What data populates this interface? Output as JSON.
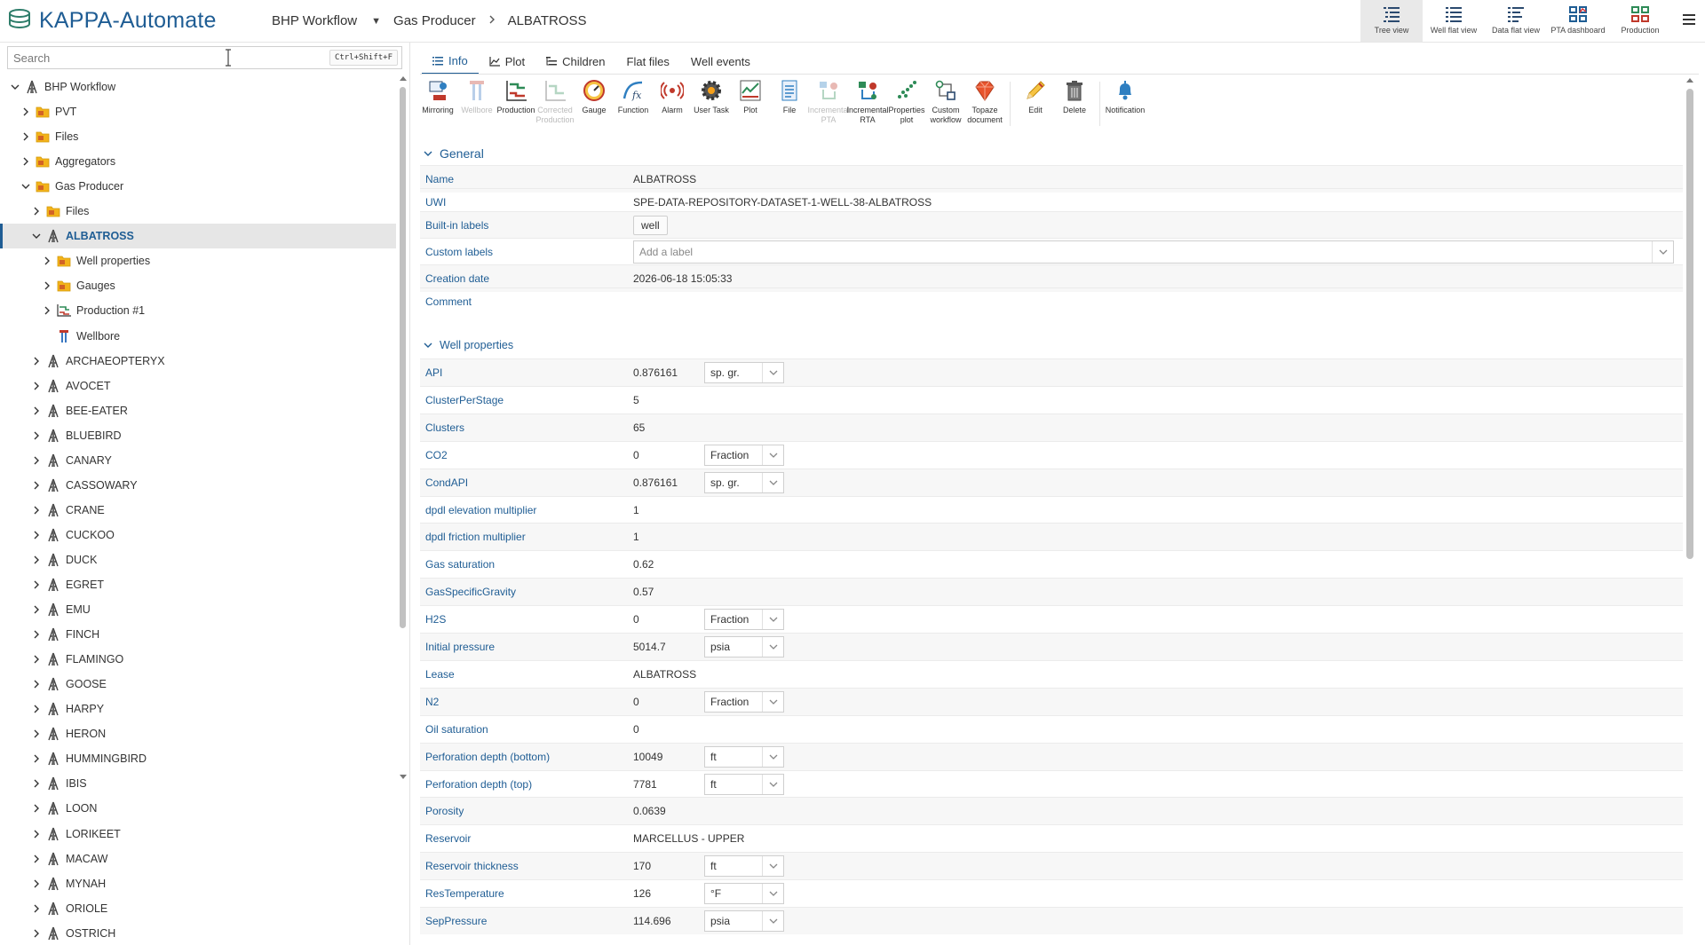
{
  "app": {
    "title": "KAPPA-Automate"
  },
  "breadcrumb": [
    "BHP Workflow",
    "Gas Producer",
    "ALBATROSS"
  ],
  "view_buttons": [
    {
      "label": "Tree view",
      "icon": "tree-view-icon",
      "active": true
    },
    {
      "label": "Well flat view",
      "icon": "list-icon",
      "active": false
    },
    {
      "label": "Data flat view",
      "icon": "list-icon",
      "active": false
    },
    {
      "label": "PTA dashboard",
      "icon": "dashboard-icon",
      "active": false
    },
    {
      "label": "Production",
      "icon": "grid-icon",
      "active": false
    }
  ],
  "search": {
    "placeholder": "Search",
    "shortcut": "Ctrl+Shift+F"
  },
  "tree": [
    {
      "label": "BHP Workflow",
      "level": 0,
      "expanded": true,
      "icon": "well-icon"
    },
    {
      "label": "PVT",
      "level": 1,
      "expanded": false,
      "icon": "folder-icon"
    },
    {
      "label": "Files",
      "level": 1,
      "expanded": false,
      "icon": "folder-icon"
    },
    {
      "label": "Aggregators",
      "level": 1,
      "expanded": false,
      "icon": "folder-icon"
    },
    {
      "label": "Gas Producer",
      "level": 1,
      "expanded": true,
      "icon": "folder-icon"
    },
    {
      "label": "Files",
      "level": 2,
      "expanded": false,
      "icon": "folder-icon"
    },
    {
      "label": "ALBATROSS",
      "level": 2,
      "expanded": true,
      "icon": "well-icon",
      "selected": true
    },
    {
      "label": "Well properties",
      "level": 3,
      "expanded": false,
      "icon": "folder-icon"
    },
    {
      "label": "Gauges",
      "level": 3,
      "expanded": false,
      "icon": "folder-icon"
    },
    {
      "label": "Production #1",
      "level": 3,
      "expanded": false,
      "icon": "production-icon"
    },
    {
      "label": "Wellbore",
      "level": 3,
      "expanded": null,
      "icon": "wellbore-icon"
    },
    {
      "label": "ARCHAEOPTERYX",
      "level": 2,
      "expanded": false,
      "icon": "well-icon"
    },
    {
      "label": "AVOCET",
      "level": 2,
      "expanded": false,
      "icon": "well-icon"
    },
    {
      "label": "BEE-EATER",
      "level": 2,
      "expanded": false,
      "icon": "well-icon"
    },
    {
      "label": "BLUEBIRD",
      "level": 2,
      "expanded": false,
      "icon": "well-icon"
    },
    {
      "label": "CANARY",
      "level": 2,
      "expanded": false,
      "icon": "well-icon"
    },
    {
      "label": "CASSOWARY",
      "level": 2,
      "expanded": false,
      "icon": "well-icon"
    },
    {
      "label": "CRANE",
      "level": 2,
      "expanded": false,
      "icon": "well-icon"
    },
    {
      "label": "CUCKOO",
      "level": 2,
      "expanded": false,
      "icon": "well-icon"
    },
    {
      "label": "DUCK",
      "level": 2,
      "expanded": false,
      "icon": "well-icon"
    },
    {
      "label": "EGRET",
      "level": 2,
      "expanded": false,
      "icon": "well-icon"
    },
    {
      "label": "EMU",
      "level": 2,
      "expanded": false,
      "icon": "well-icon"
    },
    {
      "label": "FINCH",
      "level": 2,
      "expanded": false,
      "icon": "well-icon"
    },
    {
      "label": "FLAMINGO",
      "level": 2,
      "expanded": false,
      "icon": "well-icon"
    },
    {
      "label": "GOOSE",
      "level": 2,
      "expanded": false,
      "icon": "well-icon"
    },
    {
      "label": "HARPY",
      "level": 2,
      "expanded": false,
      "icon": "well-icon"
    },
    {
      "label": "HERON",
      "level": 2,
      "expanded": false,
      "icon": "well-icon"
    },
    {
      "label": "HUMMINGBIRD",
      "level": 2,
      "expanded": false,
      "icon": "well-icon"
    },
    {
      "label": "IBIS",
      "level": 2,
      "expanded": false,
      "icon": "well-icon"
    },
    {
      "label": "LOON",
      "level": 2,
      "expanded": false,
      "icon": "well-icon"
    },
    {
      "label": "LORIKEET",
      "level": 2,
      "expanded": false,
      "icon": "well-icon"
    },
    {
      "label": "MACAW",
      "level": 2,
      "expanded": false,
      "icon": "well-icon"
    },
    {
      "label": "MYNAH",
      "level": 2,
      "expanded": false,
      "icon": "well-icon"
    },
    {
      "label": "ORIOLE",
      "level": 2,
      "expanded": false,
      "icon": "well-icon"
    },
    {
      "label": "OSTRICH",
      "level": 2,
      "expanded": false,
      "icon": "well-icon"
    }
  ],
  "tabs": [
    {
      "label": "Info",
      "icon": "list-icon",
      "active": true
    },
    {
      "label": "Plot",
      "icon": "plot-icon",
      "active": false
    },
    {
      "label": "Children",
      "icon": "children-icon",
      "active": false
    },
    {
      "label": "Flat files",
      "icon": null,
      "active": false
    },
    {
      "label": "Well events",
      "icon": null,
      "active": false
    }
  ],
  "toolbar": [
    {
      "label": "Mirroring",
      "icon": "mirroring-icon",
      "enabled": true
    },
    {
      "label": "Wellbore",
      "icon": "wellbore-icon",
      "enabled": false
    },
    {
      "label": "Production",
      "icon": "production-icon",
      "enabled": true
    },
    {
      "label": "Corrected Production",
      "icon": "corrected-production-icon",
      "enabled": false
    },
    {
      "label": "Gauge",
      "icon": "gauge-icon",
      "enabled": true
    },
    {
      "label": "Function",
      "icon": "function-icon",
      "enabled": true
    },
    {
      "label": "Alarm",
      "icon": "alarm-icon",
      "enabled": true
    },
    {
      "label": "User Task",
      "icon": "gear-icon",
      "enabled": true
    },
    {
      "label": "Plot",
      "icon": "plot-icon",
      "enabled": true
    },
    {
      "label": "File",
      "icon": "file-icon",
      "enabled": true
    },
    {
      "label": "Incremental PTA",
      "icon": "incremental-pta-icon",
      "enabled": false
    },
    {
      "label": "Incremental RTA",
      "icon": "incremental-rta-icon",
      "enabled": true
    },
    {
      "label": "Properties plot",
      "icon": "scatter-icon",
      "enabled": true
    },
    {
      "label": "Custom workflow",
      "icon": "workflow-icon",
      "enabled": true
    },
    {
      "label": "Topaze document",
      "icon": "topaze-icon",
      "enabled": true
    },
    {
      "label": "Edit",
      "icon": "pencil-icon",
      "enabled": true,
      "sep_before": true
    },
    {
      "label": "Delete",
      "icon": "trash-icon",
      "enabled": true
    },
    {
      "label": "Notification",
      "icon": "bell-icon",
      "enabled": true,
      "sep_before": true
    }
  ],
  "general": {
    "title": "General",
    "rows": [
      {
        "label": "Name",
        "value": "ALBATROSS"
      },
      {
        "label": "UWI",
        "value": "SPE-DATA-REPOSITORY-DATASET-1-WELL-38-ALBATROSS"
      },
      {
        "label": "Built-in labels",
        "chip": "well"
      },
      {
        "label": "Custom labels",
        "placeholder": "Add a label"
      },
      {
        "label": "Creation date",
        "value": "2026-06-18 15:05:33"
      },
      {
        "label": "Comment",
        "value": ""
      }
    ]
  },
  "well_properties": {
    "title": "Well properties",
    "rows": [
      {
        "label": "API",
        "value": "0.876161",
        "unit": "sp. gr."
      },
      {
        "label": "ClusterPerStage",
        "value": "5"
      },
      {
        "label": "Clusters",
        "value": "65"
      },
      {
        "label": "CO2",
        "value": "0",
        "unit": "Fraction"
      },
      {
        "label": "CondAPI",
        "value": "0.876161",
        "unit": "sp. gr."
      },
      {
        "label": "dpdl elevation multiplier",
        "value": "1"
      },
      {
        "label": "dpdl friction multiplier",
        "value": "1"
      },
      {
        "label": "Gas saturation",
        "value": "0.62"
      },
      {
        "label": "GasSpecificGravity",
        "value": "0.57"
      },
      {
        "label": "H2S",
        "value": "0",
        "unit": "Fraction"
      },
      {
        "label": "Initial pressure",
        "value": "5014.7",
        "unit": "psia"
      },
      {
        "label": "Lease",
        "value": "ALBATROSS"
      },
      {
        "label": "N2",
        "value": "0",
        "unit": "Fraction"
      },
      {
        "label": "Oil saturation",
        "value": "0"
      },
      {
        "label": "Perforation depth (bottom)",
        "value": "10049",
        "unit": "ft"
      },
      {
        "label": "Perforation depth (top)",
        "value": "7781",
        "unit": "ft"
      },
      {
        "label": "Porosity",
        "value": "0.0639"
      },
      {
        "label": "Reservoir",
        "value": "MARCELLUS - UPPER"
      },
      {
        "label": "Reservoir thickness",
        "value": "170",
        "unit": "ft"
      },
      {
        "label": "ResTemperature",
        "value": "126",
        "unit": "°F"
      },
      {
        "label": "SepPressure",
        "value": "114.696",
        "unit": "psia"
      }
    ]
  },
  "colors": {
    "brand": "#1f5d94",
    "accent": "#2f7fc1",
    "selected_bg": "#e6e6e6"
  }
}
